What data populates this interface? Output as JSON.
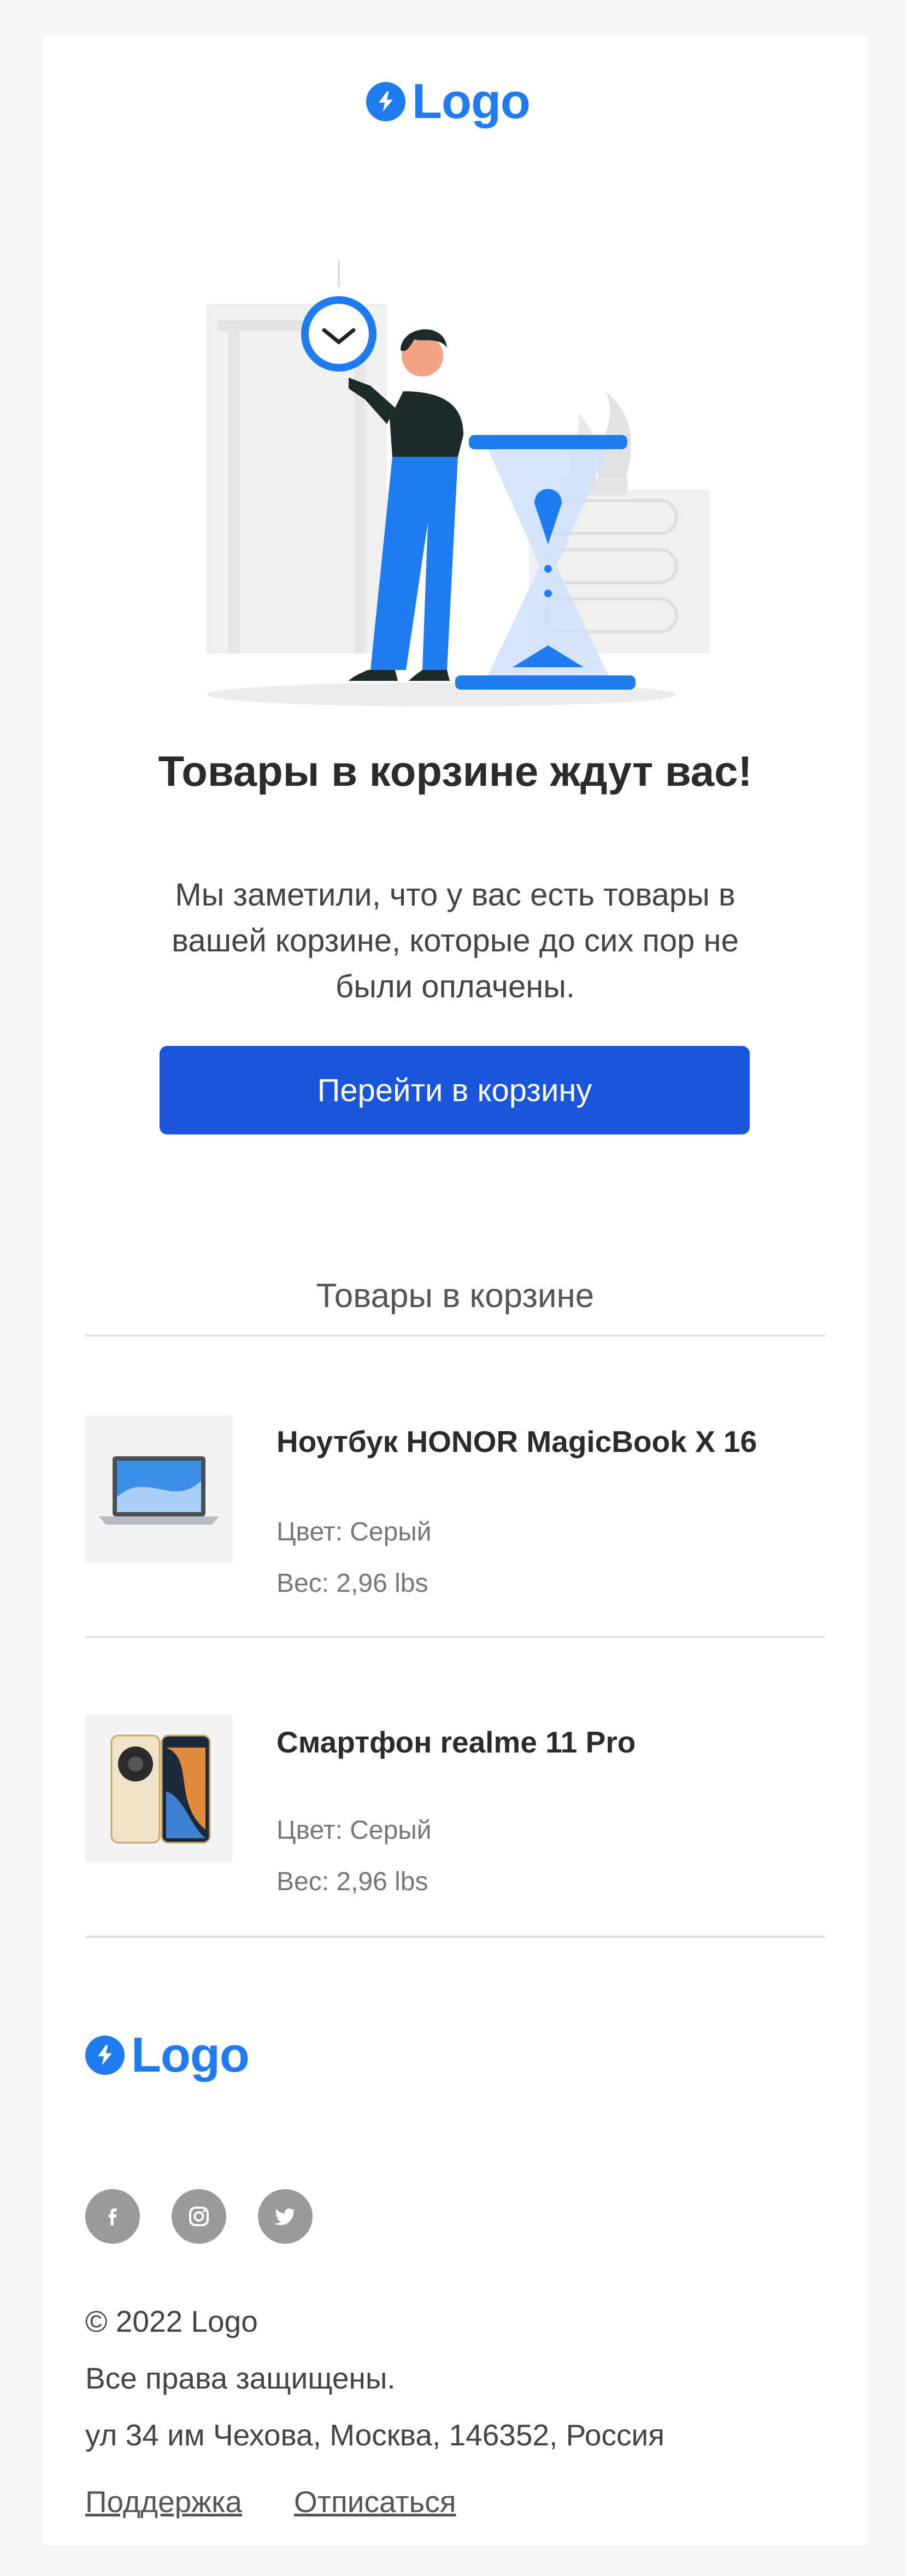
{
  "header": {
    "logo_text": "Logo",
    "logo_icon": "lightning-bolt-icon"
  },
  "hero": {
    "illustration": "person-hourglass-clock-illustration"
  },
  "headline": "Товары в корзине ждут вас!",
  "lead": "Мы заметили, что у вас есть товары в вашей корзине, которые до сих пор не были оплачены.",
  "cta_label": "Перейти в корзину",
  "cart": {
    "section_title": "Товары в корзине",
    "items": [
      {
        "name": "Ноутбук HONOR MagicBook X 16",
        "color": "Цвет: Серый",
        "weight": "Вес: 2,96 lbs",
        "image": "laptop-image"
      },
      {
        "name": "Смартфон realme 11 Pro",
        "color": "Цвет: Серый",
        "weight": "Вес: 2,96 lbs",
        "image": "smartphone-image"
      }
    ]
  },
  "footer": {
    "logo_text": "Logo",
    "social": [
      "facebook-icon",
      "instagram-icon",
      "twitter-icon"
    ],
    "copyright": "© 2022 Logo",
    "rights": "Все права защищены.",
    "address": "ул 34 им Чехова, Москва, 146352, Россия",
    "links": {
      "support": "Поддержка",
      "unsubscribe": "Отписаться"
    }
  },
  "colors": {
    "brand": "#1f7cf0",
    "button": "#1a56db",
    "social": "#9a9a9a"
  }
}
